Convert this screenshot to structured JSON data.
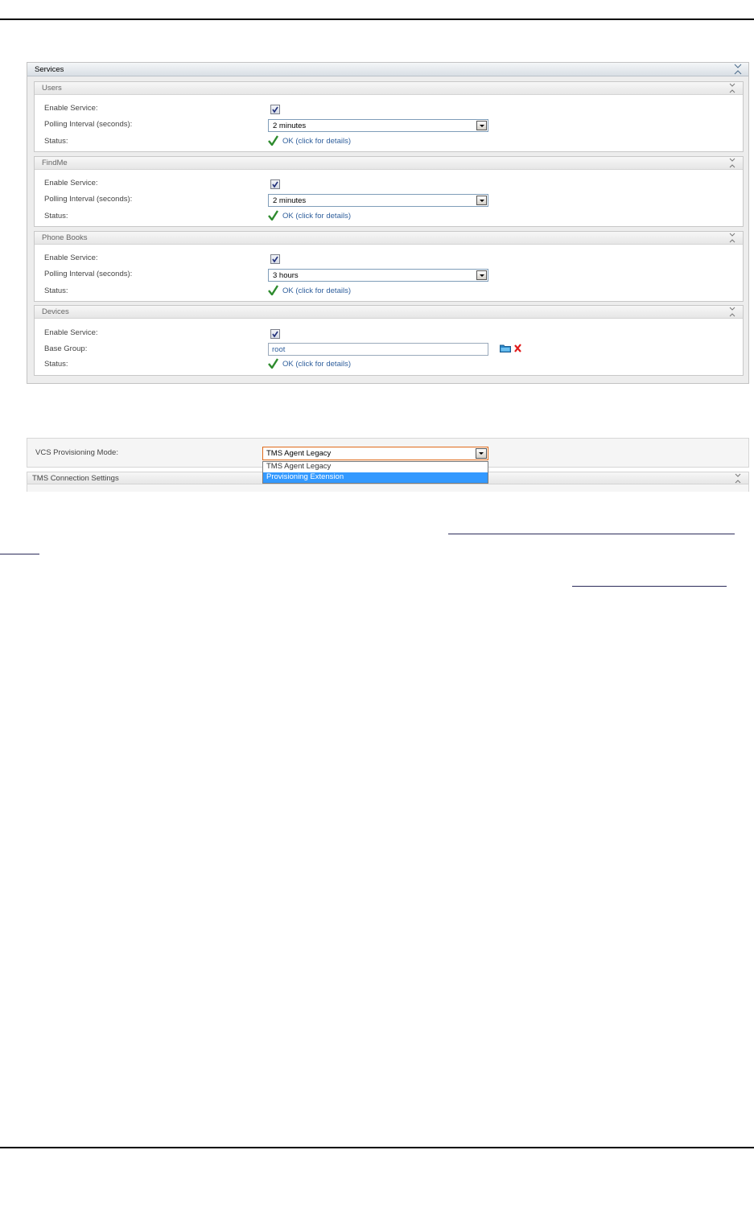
{
  "services": {
    "title": "Services",
    "sections": [
      {
        "title": "Users",
        "enable_label": "Enable Service:",
        "enabled": true,
        "interval_label": "Polling Interval (seconds):",
        "interval_value": "2 minutes",
        "status_label": "Status:",
        "status_text": "OK (click for details)"
      },
      {
        "title": "FindMe",
        "enable_label": "Enable Service:",
        "enabled": true,
        "interval_label": "Polling Interval (seconds):",
        "interval_value": "2 minutes",
        "status_label": "Status:",
        "status_text": "OK (click for details)"
      },
      {
        "title": "Phone Books",
        "enable_label": "Enable Service:",
        "enabled": true,
        "interval_label": "Polling Interval (seconds):",
        "interval_value": "3 hours",
        "status_label": "Status:",
        "status_text": "OK (click for details)"
      },
      {
        "title": "Devices",
        "enable_label": "Enable Service:",
        "enabled": true,
        "base_group_label": "Base Group:",
        "base_group_value": "root",
        "status_label": "Status:",
        "status_text": "OK (click for details)"
      }
    ]
  },
  "provisioning": {
    "mode_label": "VCS Provisioning Mode:",
    "mode_value": "TMS Agent Legacy",
    "options": [
      "TMS Agent Legacy",
      "Provisioning Extension"
    ],
    "highlighted_option": "Provisioning Extension",
    "tms_connection_title": "TMS Connection Settings"
  },
  "colors": {
    "status_ok": "#2e8b2e",
    "link": "#2f5f9c",
    "focus_border": "#e06a19",
    "selection": "#3399ff"
  },
  "icons": {
    "status": "checkmark-icon",
    "collapse": "collapse-chevrons-icon",
    "browse": "folder-icon",
    "clear": "clear-x-icon"
  }
}
